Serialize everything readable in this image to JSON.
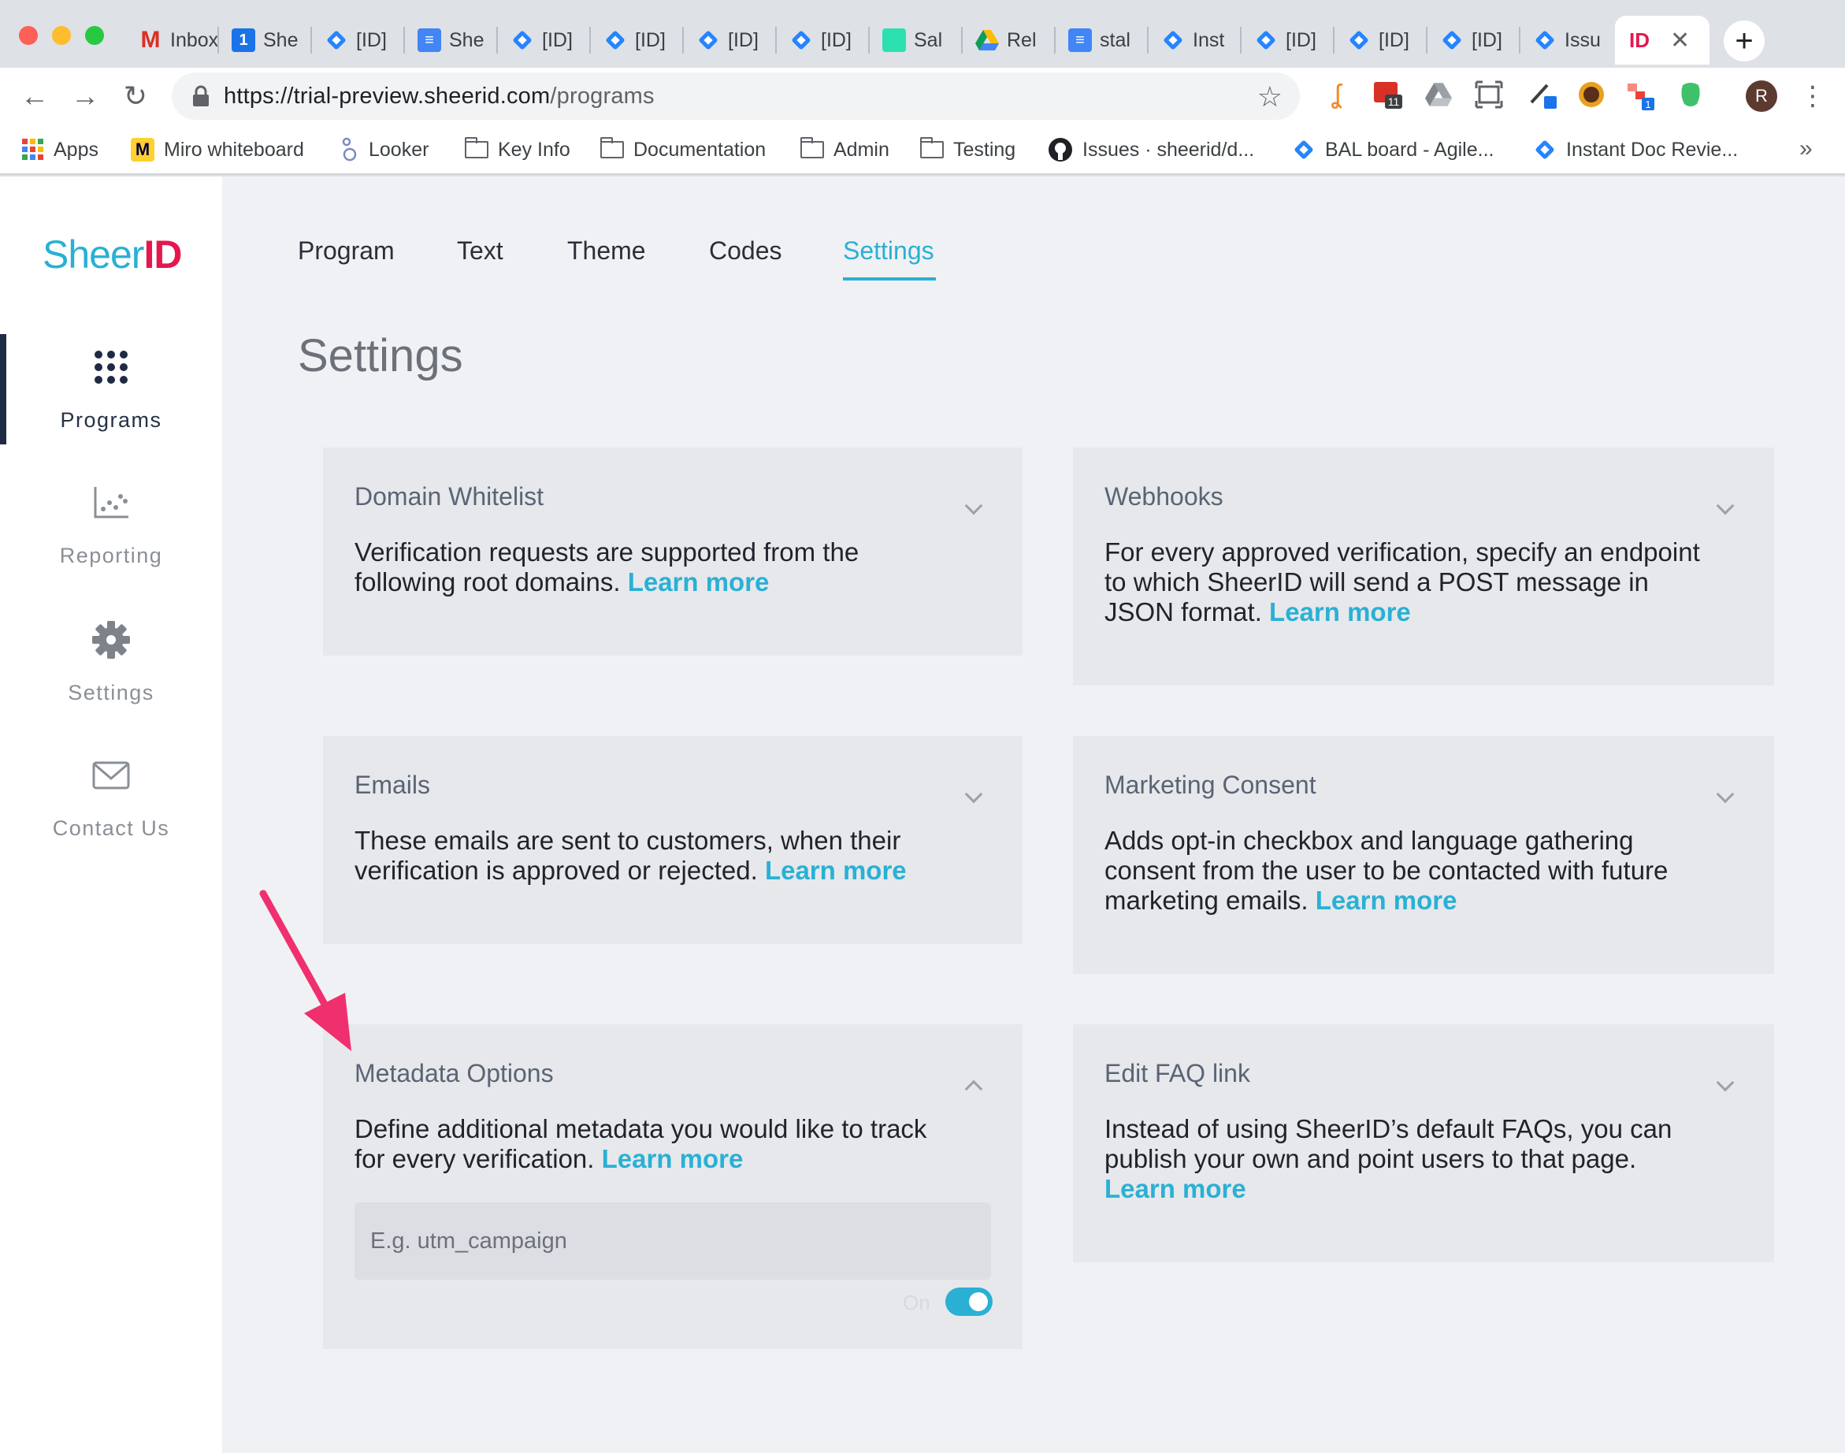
{
  "browser": {
    "tabs": [
      {
        "label": "Inbox",
        "icon": "gmail-icon"
      },
      {
        "label": "She",
        "icon": "calendar-icon"
      },
      {
        "label": "[ID]",
        "icon": "jira-icon"
      },
      {
        "label": "She",
        "icon": "docs-icon"
      },
      {
        "label": "[ID]",
        "icon": "jira-icon"
      },
      {
        "label": "[ID]",
        "icon": "jira-icon"
      },
      {
        "label": "[ID]",
        "icon": "jira-icon"
      },
      {
        "label": "[ID]",
        "icon": "jira-icon"
      },
      {
        "label": "Sal",
        "icon": "green-square-icon"
      },
      {
        "label": "Rel",
        "icon": "drive-icon"
      },
      {
        "label": "stal",
        "icon": "docs-icon"
      },
      {
        "label": "Inst",
        "icon": "jira-icon"
      },
      {
        "label": "[ID]",
        "icon": "jira-icon"
      },
      {
        "label": "[ID]",
        "icon": "jira-icon"
      },
      {
        "label": "[ID]",
        "icon": "jira-icon"
      },
      {
        "label": "Issu",
        "icon": "jira-icon"
      }
    ],
    "url_host": "https://trial-preview.sheerid.com",
    "url_path": "/programs",
    "avatar_letter": "R",
    "calendar_badge": "11",
    "ext_badge": "1",
    "bookmarks": [
      {
        "label": "Apps"
      },
      {
        "label": "Miro whiteboard"
      },
      {
        "label": "Looker"
      },
      {
        "label": "Key Info"
      },
      {
        "label": "Documentation"
      },
      {
        "label": "Admin"
      },
      {
        "label": "Testing"
      },
      {
        "label": "Issues · sheerid/d..."
      },
      {
        "label": "BAL board - Agile..."
      },
      {
        "label": "Instant Doc Revie..."
      }
    ],
    "bookmarks_overflow": "»"
  },
  "brand": {
    "name_a": "Sheer",
    "name_b": "ID"
  },
  "sidebar": {
    "items": [
      {
        "label": "Programs",
        "icon": "grid-dots-icon",
        "active": true
      },
      {
        "label": "Reporting",
        "icon": "scatter-chart-icon",
        "active": false
      },
      {
        "label": "Settings",
        "icon": "gear-icon",
        "active": false
      },
      {
        "label": "Contact Us",
        "icon": "envelope-icon",
        "active": false
      }
    ]
  },
  "program_tabs": [
    {
      "label": "Program"
    },
    {
      "label": "Text"
    },
    {
      "label": "Theme"
    },
    {
      "label": "Codes"
    },
    {
      "label": "Settings",
      "active": true
    }
  ],
  "page_title": "Settings",
  "cards": {
    "domain": {
      "title": "Domain Whitelist",
      "desc": "Verification requests are supported from the following root domains.",
      "link": "Learn more"
    },
    "webhooks": {
      "title": "Webhooks",
      "desc": "For every approved verification, specify an endpoint to which SheerID will send a POST message in JSON format.",
      "link": "Learn more"
    },
    "emails": {
      "title": "Emails",
      "desc": "These emails are sent to customers, when their verification is approved or rejected.",
      "link": "Learn more"
    },
    "marketing": {
      "title": "Marketing Consent",
      "desc": "Adds opt-in checkbox and language gathering consent from the user to be contacted with future marketing emails.",
      "link": "Learn more"
    },
    "metadata": {
      "title": "Metadata Options",
      "desc": "Define additional metadata you would like to track for every verification.",
      "link": "Learn more",
      "placeholder": "E.g. utm_campaign",
      "toggle_label": "On",
      "toggle_on": true
    },
    "faq": {
      "title": "Edit FAQ link",
      "desc": "Instead of using SheerID’s default FAQs, you can publish your own and point users to that page.",
      "link": "Learn more"
    }
  },
  "colors": {
    "accent": "#2ab0d4",
    "brand_red": "#e5174f",
    "annotation_arrow": "#f0306e"
  }
}
